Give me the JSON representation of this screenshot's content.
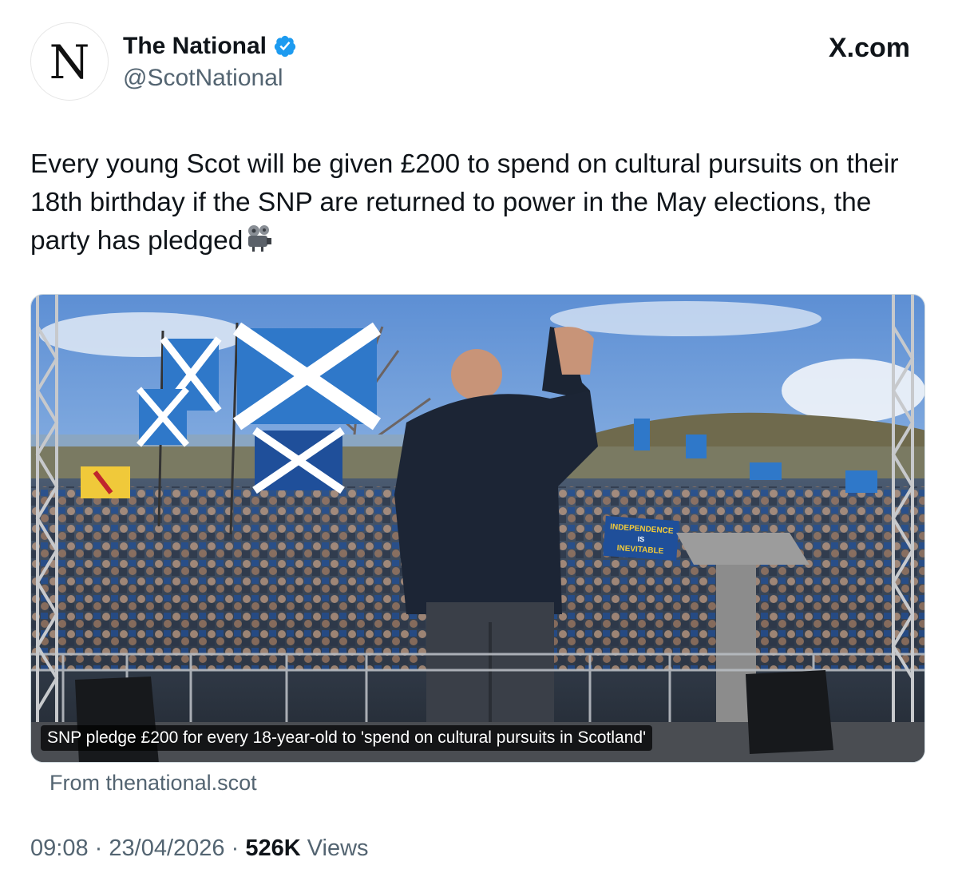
{
  "author": {
    "avatar_letter": "N",
    "display_name": "The National",
    "handle": "@ScotNational",
    "verified": true,
    "verified_badge_color": "#1d9bf0"
  },
  "brand": {
    "site": "X.com"
  },
  "tweet": {
    "text": "Every young Scot will be given £200 to spend on cultural pursuits on their 18th birthday if the SNP are returned to power in the May elections, the party has pledged",
    "emoji": "film-projector-emoji"
  },
  "link_card": {
    "caption": "SNP pledge £200 for every 18-year-old to 'spend on cultural pursuits in Scotland'",
    "source": "From thenational.scot",
    "image_banner_text": [
      "INDEPENDENCE",
      "IS",
      "INEVITABLE"
    ]
  },
  "meta": {
    "time": "09:08",
    "date": "23/04/2026",
    "views_count": "526K",
    "views_label": "Views",
    "separator": "·"
  },
  "colors": {
    "text_primary": "#0f1419",
    "text_secondary": "#536471",
    "saltire_blue": "#1f5fb8"
  }
}
